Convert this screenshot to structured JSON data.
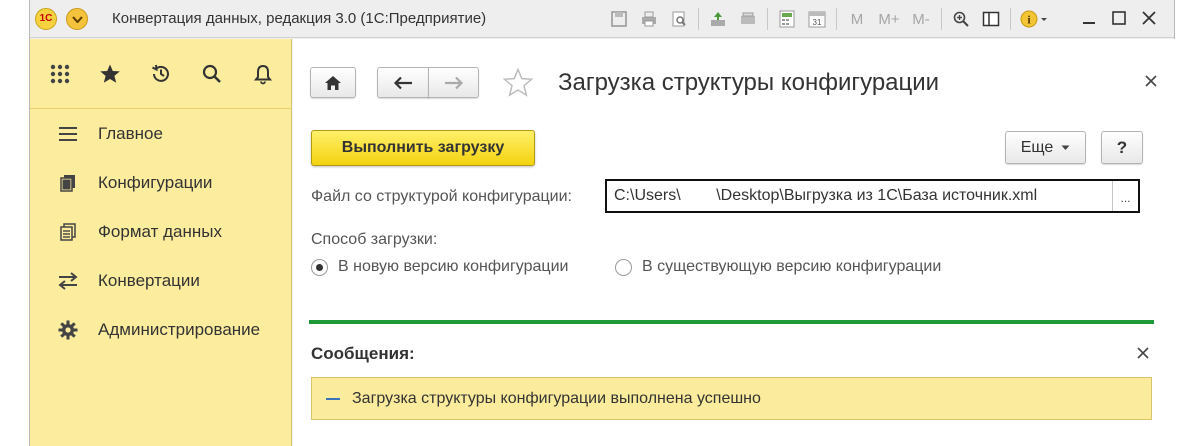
{
  "window": {
    "title": "Конвертация данных, редакция 3.0  (1С:Предприятие)",
    "logo_text": "1С",
    "toolbar_memory": [
      "M",
      "M+",
      "M-"
    ]
  },
  "sidebar": {
    "top_icons": [
      "apps-grid-icon",
      "star-icon",
      "history-icon",
      "search-icon",
      "bell-icon"
    ],
    "items": [
      {
        "label": "Главное",
        "icon": "menu-lines-icon"
      },
      {
        "label": "Конфигурации",
        "icon": "documents-icon"
      },
      {
        "label": "Формат данных",
        "icon": "format-doc-icon"
      },
      {
        "label": "Конвертации",
        "icon": "swap-arrows-icon"
      },
      {
        "label": "Администрирование",
        "icon": "gear-icon"
      }
    ]
  },
  "form": {
    "title": "Загрузка структуры конфигурации",
    "run_button": "Выполнить загрузку",
    "more_button": "Еще",
    "help_button": "?",
    "file_label": "Файл со структурой конфигурации:",
    "file_value": "C:\\Users\\        \\Desktop\\Выгрузка из 1С\\База источник.xml",
    "file_pick": "...",
    "mode_label": "Способ загрузки:",
    "mode_options": [
      {
        "label": "В новую версию конфигурации",
        "selected": true
      },
      {
        "label": "В существующую версию конфигурации",
        "selected": false
      }
    ]
  },
  "messages": {
    "title": "Сообщения:",
    "items": [
      "Загрузка структуры конфигурации выполнена успешно"
    ]
  },
  "colors": {
    "sidebar_bg": "#fcec9e",
    "run_button": "#f3d20f",
    "divider": "#1e9a3a",
    "message_bg": "#fbeb9c"
  }
}
